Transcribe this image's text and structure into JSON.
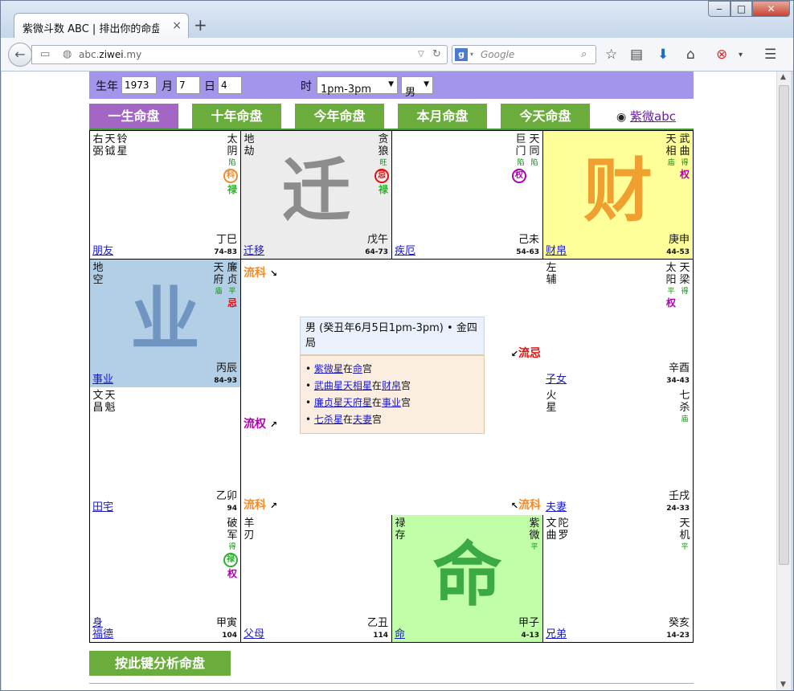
{
  "browser": {
    "tab_title": "紫微斗数 ABC | 排出你的命盘 | ...",
    "tab_close": "×",
    "new_tab": "+",
    "url_prefix": "abc.",
    "url_domain": "ziwei",
    "url_suffix": ".my",
    "search_placeholder": "Google",
    "window_min": "‒",
    "window_max": "□",
    "window_close": "✕"
  },
  "form": {
    "year_label": "生年",
    "year_value": "1973",
    "month_label": "月",
    "month_value": "7",
    "day_label": "日",
    "day_value": "4",
    "hour_label": "时",
    "hour_value": "1pm-3pm",
    "gender_value": "男"
  },
  "tabs": [
    "一生命盘",
    "十年命盘",
    "今年命盘",
    "本月命盘",
    "今天命盘"
  ],
  "brand": "紫微abc",
  "cells": [
    {
      "big": "",
      "bg": "#ffffff",
      "left": [
        "右铃",
        "天钺",
        "铃星"
      ],
      "gz": "丁巳",
      "age": "74-83",
      "palace": "朋友"
    },
    {
      "big": "迁",
      "bg": "#ececec",
      "gz": "戊午",
      "age": "64-73",
      "palace": "迁移"
    },
    {
      "big": "",
      "bg": "#ffffff",
      "gz": "己未",
      "age": "54-63",
      "palace": "疾厄"
    },
    {
      "big": "财",
      "bg": "#ffff99",
      "gz": "庚申",
      "age": "44-53",
      "palace": "财帛"
    },
    {
      "big": "业",
      "bg": "#b3cfe6",
      "gz": "丙辰",
      "age": "84-93",
      "palace": "事业"
    },
    {
      "big": "",
      "bg": "#ffffff",
      "gz": "辛酉",
      "age": "34-43",
      "palace": "子女"
    },
    {
      "big": "",
      "bg": "#ffffff",
      "gz": "乙卯",
      "age": "94",
      "palace": "田宅"
    },
    {
      "big": "",
      "bg": "#ffffff",
      "gz": "壬戌",
      "age": "24-33",
      "palace": "夫妻"
    },
    {
      "big": "",
      "bg": "#ffffff",
      "gz": "甲寅",
      "age": "104",
      "palace": "福德",
      "shen": "身"
    },
    {
      "big": "",
      "bg": "#ffffff",
      "gz": "乙丑",
      "age": "114",
      "palace": "父母"
    },
    {
      "big": "命",
      "bg": "#c0ffa8",
      "gz": "甲子",
      "age": "4-13",
      "palace": "命"
    },
    {
      "big": "",
      "bg": "#ffffff",
      "gz": "癸亥",
      "age": "14-23",
      "palace": "兄弟"
    }
  ],
  "stars": {
    "c0_left": [
      [
        "右",
        "弼"
      ],
      [
        "天",
        "钺"
      ],
      [
        "铃",
        "星"
      ]
    ],
    "c0_right": [
      {
        "t": [
          "太",
          "阴"
        ],
        "b": "陷",
        "mk": "科",
        "mk2": "禄"
      }
    ],
    "c1_left": [
      [
        "地",
        "劫"
      ]
    ],
    "c1_right": [
      {
        "t": [
          "贪",
          "狼"
        ],
        "b": "旺",
        "mk": "忌",
        "mk2": "禄"
      }
    ],
    "c2_right": [
      {
        "t": [
          "天",
          "同"
        ],
        "b": "陷"
      },
      {
        "t": [
          "巨",
          "门"
        ],
        "b": "陷",
        "mk": "权"
      }
    ],
    "c3_right": [
      {
        "t": [
          "武",
          "曲"
        ],
        "b": "得",
        "mk": "权"
      },
      {
        "t": [
          "天",
          "相"
        ],
        "b": "庙"
      }
    ],
    "c4_left": [
      [
        "地",
        "空"
      ]
    ],
    "c4_right": [
      {
        "t": [
          "廉",
          "贞"
        ],
        "b": "平",
        "mk": "忌"
      },
      {
        "t": [
          "天",
          "府"
        ],
        "b": "庙"
      }
    ],
    "c5_left": [
      [
        "左",
        "辅"
      ]
    ],
    "c5_right": [
      {
        "t": [
          "天",
          "梁"
        ],
        "b": "得"
      },
      {
        "t": [
          "太",
          "阳"
        ],
        "b": "平",
        "mk": "权"
      }
    ],
    "c6_left": [
      [
        "文",
        "昌"
      ],
      [
        "天",
        "魁"
      ]
    ],
    "c7_left": [
      [
        "火",
        "星"
      ]
    ],
    "c7_right": [
      {
        "t": [
          "七",
          "杀"
        ],
        "b": "庙"
      }
    ],
    "c8_right": [
      {
        "t": [
          "破",
          "军"
        ],
        "b": "得",
        "mk": "禄",
        "mk2": "权"
      }
    ],
    "c9_left": [
      [
        "羊",
        "刃"
      ]
    ],
    "c10_left": [
      [
        "禄",
        "存"
      ]
    ],
    "c10_right": [
      {
        "t": [
          "紫",
          "微"
        ],
        "b": "平"
      }
    ],
    "c11_left": [
      [
        "文",
        "曲"
      ],
      [
        "陀",
        "罗"
      ]
    ],
    "c11_right": [
      {
        "t": [
          "天",
          "机"
        ],
        "b": "平"
      }
    ]
  },
  "center": {
    "flow_top": "流科",
    "flow_right": "流忌",
    "flow_left": "流权",
    "flow_bl": "流科",
    "flow_br": "流科",
    "info": "男 (癸丑年6月5日1pm-3pm) • 金四局",
    "list": [
      {
        "a": "紫微星",
        "mid": "在",
        "b": "命",
        "end": "宫"
      },
      {
        "a": "武曲星天相星",
        "mid": "在",
        "b": "财帛",
        "end": "宫"
      },
      {
        "a": "廉贞星天府星",
        "mid": "在",
        "b": "事业",
        "end": "宫"
      },
      {
        "a": "七杀星",
        "mid": "在",
        "b": "夫妻",
        "end": "宫"
      }
    ]
  },
  "analyze_button": "按此键分析命盘",
  "colors": {
    "purple": "#a395ec",
    "green": "#6aad3d",
    "active_tab": "#a366c4",
    "orange": "#f08c28",
    "red": "#e01010",
    "magenta": "#b000b0",
    "bigtext": "#999999"
  }
}
